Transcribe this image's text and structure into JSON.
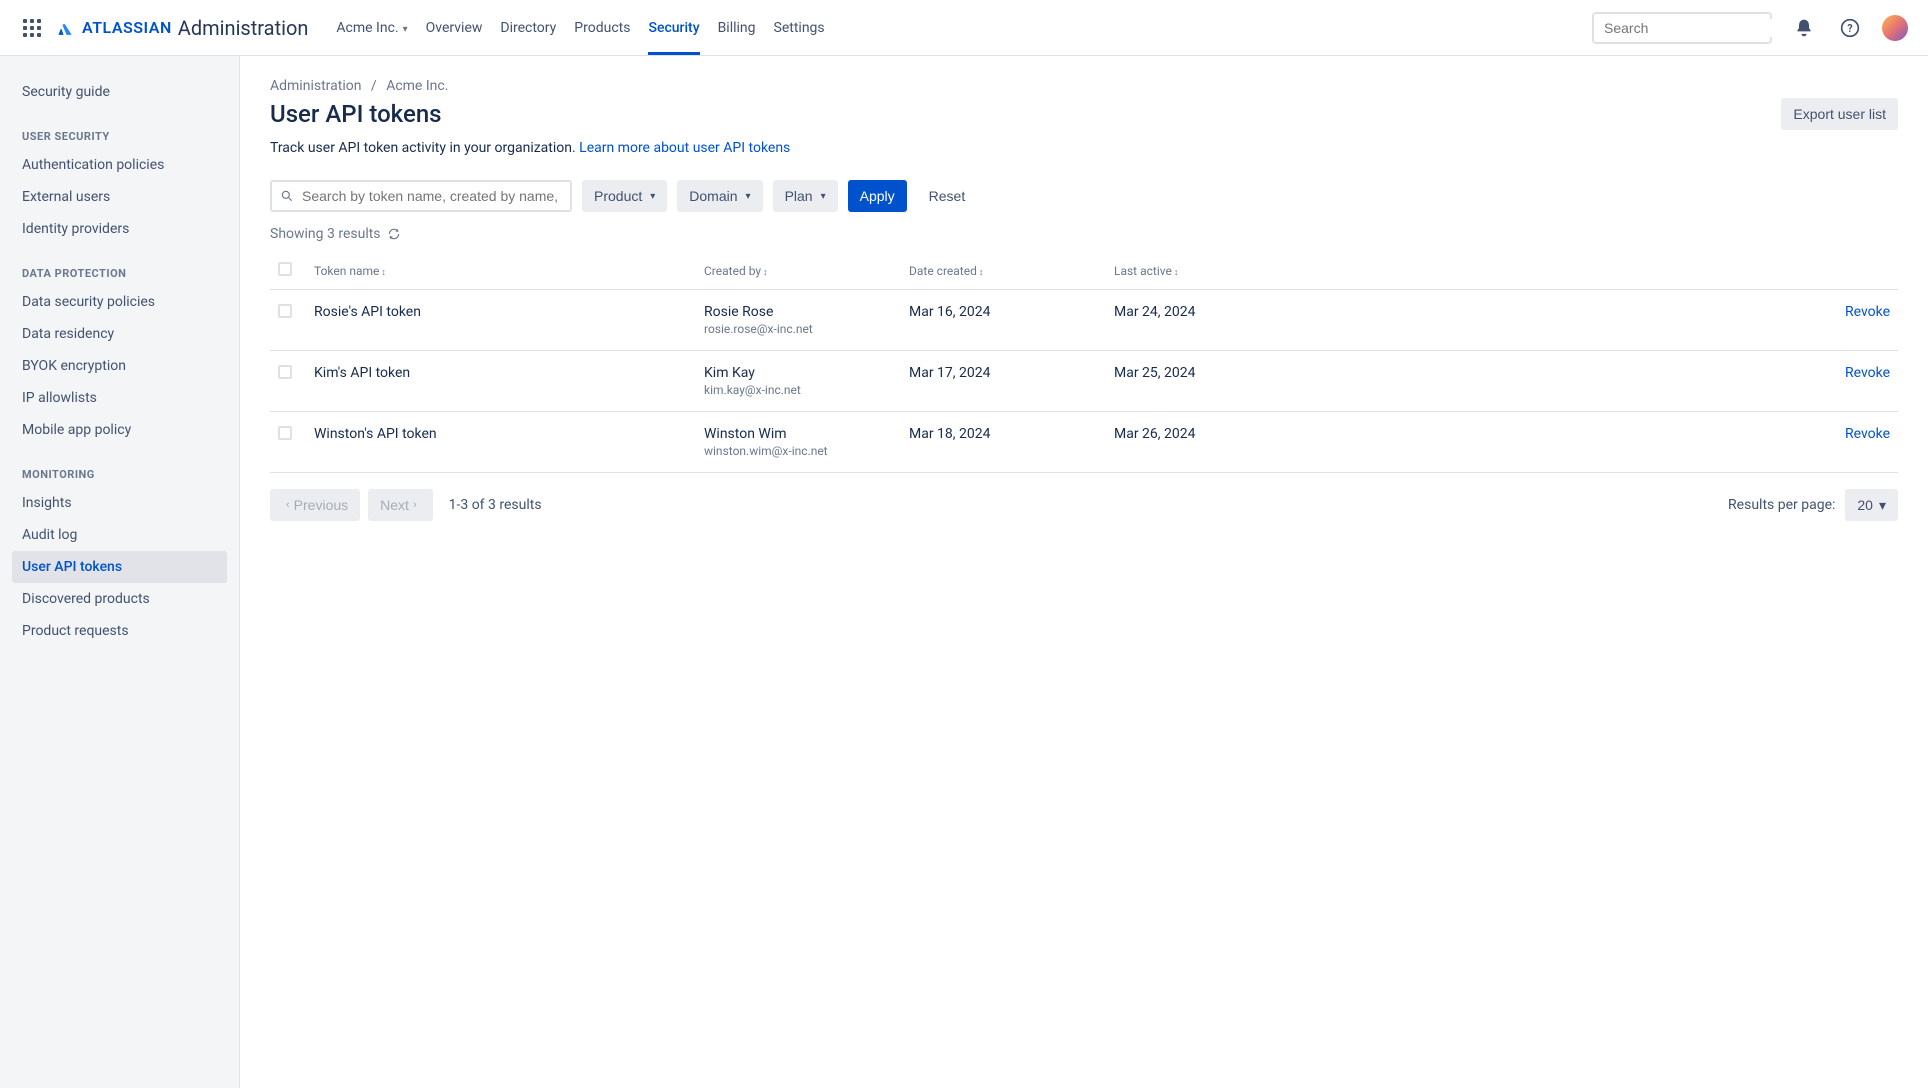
{
  "topnav": {
    "brand_bold": "ATLASSIAN",
    "brand_admin": "Administration",
    "org_name": "Acme Inc.",
    "items": [
      "Overview",
      "Directory",
      "Products",
      "Security",
      "Billing",
      "Settings"
    ],
    "active": "Security",
    "search_placeholder": "Search"
  },
  "sidebar": {
    "top": [
      "Security guide"
    ],
    "groups": [
      {
        "title": "USER SECURITY",
        "items": [
          "Authentication policies",
          "External users",
          "Identity providers"
        ]
      },
      {
        "title": "DATA PROTECTION",
        "items": [
          "Data security policies",
          "Data residency",
          "BYOK encryption",
          "IP allowlists",
          "Mobile app policy"
        ]
      },
      {
        "title": "MONITORING",
        "items": [
          "Insights",
          "Audit log",
          "User API tokens",
          "Discovered products",
          "Product requests"
        ]
      }
    ],
    "active": "User API tokens"
  },
  "crumbs": {
    "a": "Administration",
    "b": "Acme Inc."
  },
  "page": {
    "title": "User API tokens",
    "export": "Export user list",
    "desc": "Track user API token activity in your organization. ",
    "learn": "Learn more about user API tokens",
    "search_placeholder": "Search by token name, created by name, or email",
    "filters": [
      "Product",
      "Domain",
      "Plan"
    ],
    "apply": "Apply",
    "reset": "Reset",
    "showing": "Showing 3 results"
  },
  "table": {
    "headers": [
      "Token name",
      "Created by",
      "Date created",
      "Last active"
    ],
    "rows": [
      {
        "token": "Rosie's API token",
        "name": "Rosie Rose",
        "email": "rosie.rose@x-inc.net",
        "created": "Mar 16, 2024",
        "active": "Mar 24, 2024"
      },
      {
        "token": "Kim's API token",
        "name": "Kim Kay",
        "email": "kim.kay@x-inc.net",
        "created": "Mar 17, 2024",
        "active": "Mar 25, 2024"
      },
      {
        "token": "Winston's API token",
        "name": "Winston Wim",
        "email": "winston.wim@x-inc.net",
        "created": "Mar 18, 2024",
        "active": "Mar 26, 2024"
      }
    ],
    "revoke": "Revoke"
  },
  "footer": {
    "prev": "Previous",
    "next": "Next",
    "range": "1-3 of 3 results",
    "per_label": "Results per page:",
    "per_value": "20"
  }
}
